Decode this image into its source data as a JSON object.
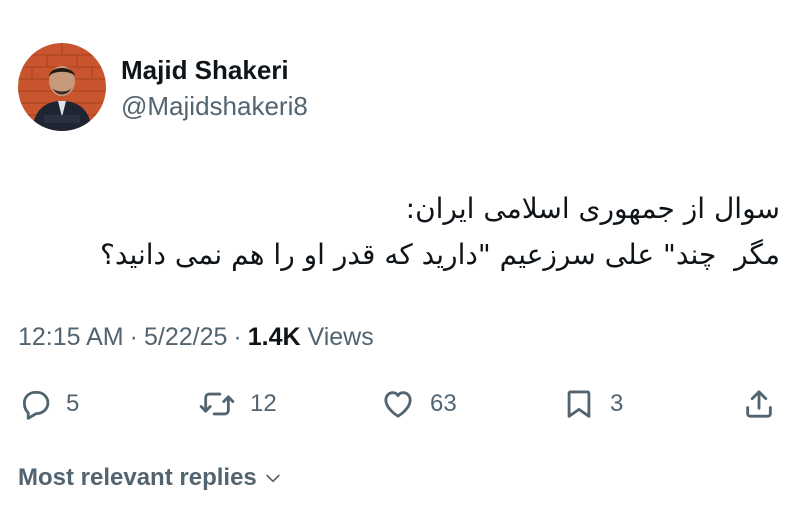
{
  "tweet": {
    "author": {
      "display_name": "Majid Shakeri",
      "handle": "@Majidshakeri8"
    },
    "text_lines": [
      "سوال از جمهوری اسلامی ایران:",
      "مگر  چند\" علی سرزعیم \"دارید که قدر او را هم نمی دانید؟"
    ],
    "time": "12:15 AM",
    "date": "5/22/25",
    "separator": "·",
    "views_count": "1.4K",
    "views_label": "Views"
  },
  "actions": {
    "reply": {
      "icon": "reply-icon",
      "count": "5"
    },
    "retweet": {
      "icon": "retweet-icon",
      "count": "12"
    },
    "like": {
      "icon": "heart-icon",
      "count": "63"
    },
    "bookmark": {
      "icon": "bookmark-icon",
      "count": "3"
    },
    "share": {
      "icon": "share-icon"
    }
  },
  "replies_sort": {
    "label": "Most relevant replies",
    "icon": "chevron-down-icon"
  },
  "colors": {
    "text_primary": "#0f1419",
    "text_secondary": "#536471",
    "avatar_background": "#c8552d"
  }
}
